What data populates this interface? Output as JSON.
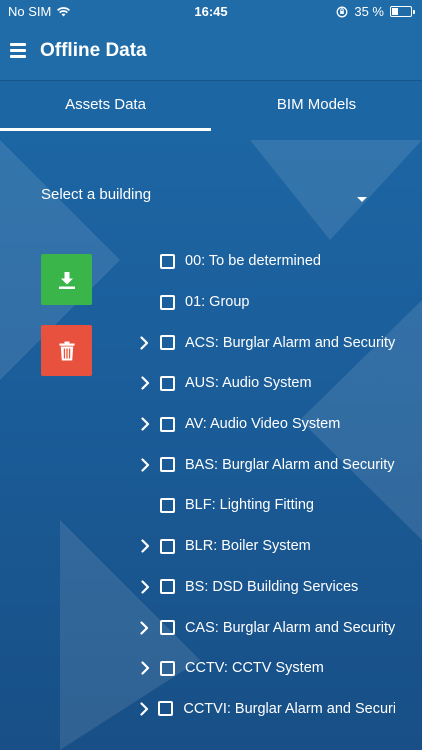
{
  "status_bar": {
    "carrier": "No SIM",
    "time": "16:45",
    "battery_percent": "35 %",
    "battery_level": 0.35
  },
  "header": {
    "title": "Offline Data",
    "menu_icon": "hamburger-menu-icon"
  },
  "tabs": [
    {
      "label": "Assets Data",
      "active": true
    },
    {
      "label": "BIM Models",
      "active": false
    }
  ],
  "building_select": {
    "placeholder": "Select a building"
  },
  "actions": {
    "download_icon": "download-icon",
    "download_color": "#39b54a",
    "delete_icon": "trash-icon",
    "delete_color": "#e8513d"
  },
  "systems": [
    {
      "label": "00: To be determined",
      "expandable": false,
      "checked": false
    },
    {
      "label": "01: Group",
      "expandable": false,
      "checked": false
    },
    {
      "label": "ACS: Burglar Alarm and Security",
      "expandable": true,
      "checked": false
    },
    {
      "label": "AUS: Audio System",
      "expandable": true,
      "checked": false
    },
    {
      "label": "AV: Audio Video System",
      "expandable": true,
      "checked": false
    },
    {
      "label": "BAS: Burglar Alarm and Security",
      "expandable": true,
      "checked": false
    },
    {
      "label": "BLF: Lighting Fitting",
      "expandable": false,
      "checked": false
    },
    {
      "label": "BLR: Boiler System",
      "expandable": true,
      "checked": false
    },
    {
      "label": "BS: DSD Building Services",
      "expandable": true,
      "checked": false
    },
    {
      "label": "CAS: Burglar Alarm and Security",
      "expandable": true,
      "checked": false
    },
    {
      "label": "CCTV: CCTV System",
      "expandable": true,
      "checked": false
    },
    {
      "label": "CCTVI: Burglar Alarm and Security",
      "expandable": true,
      "checked": false
    }
  ]
}
